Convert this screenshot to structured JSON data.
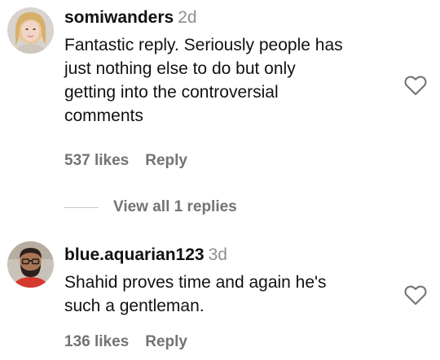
{
  "comments": [
    {
      "username": "somiwanders",
      "time": "2d",
      "text_lines": [
        "Fantastic reply. Seriously people has",
        "just nothing else to do but only",
        "getting into the controversial",
        "comments"
      ],
      "likes": "537 likes",
      "reply_label": "Reply",
      "avatar_icon": "avatar-woman-blonde",
      "like_icon": "heart-outline-icon"
    },
    {
      "username": "blue.aquarian123",
      "time": "3d",
      "text_lines": [
        "Shahid proves time and again he's",
        "such a gentleman."
      ],
      "likes": "136 likes",
      "reply_label": "Reply",
      "avatar_icon": "avatar-man-glasses-beard",
      "like_icon": "heart-outline-icon"
    }
  ],
  "view_replies": {
    "label": "View all 1 replies"
  },
  "colors": {
    "text": "#111111",
    "muted": "#737373",
    "timestamp": "#8e8e8e",
    "divider": "#c7c7c7"
  }
}
